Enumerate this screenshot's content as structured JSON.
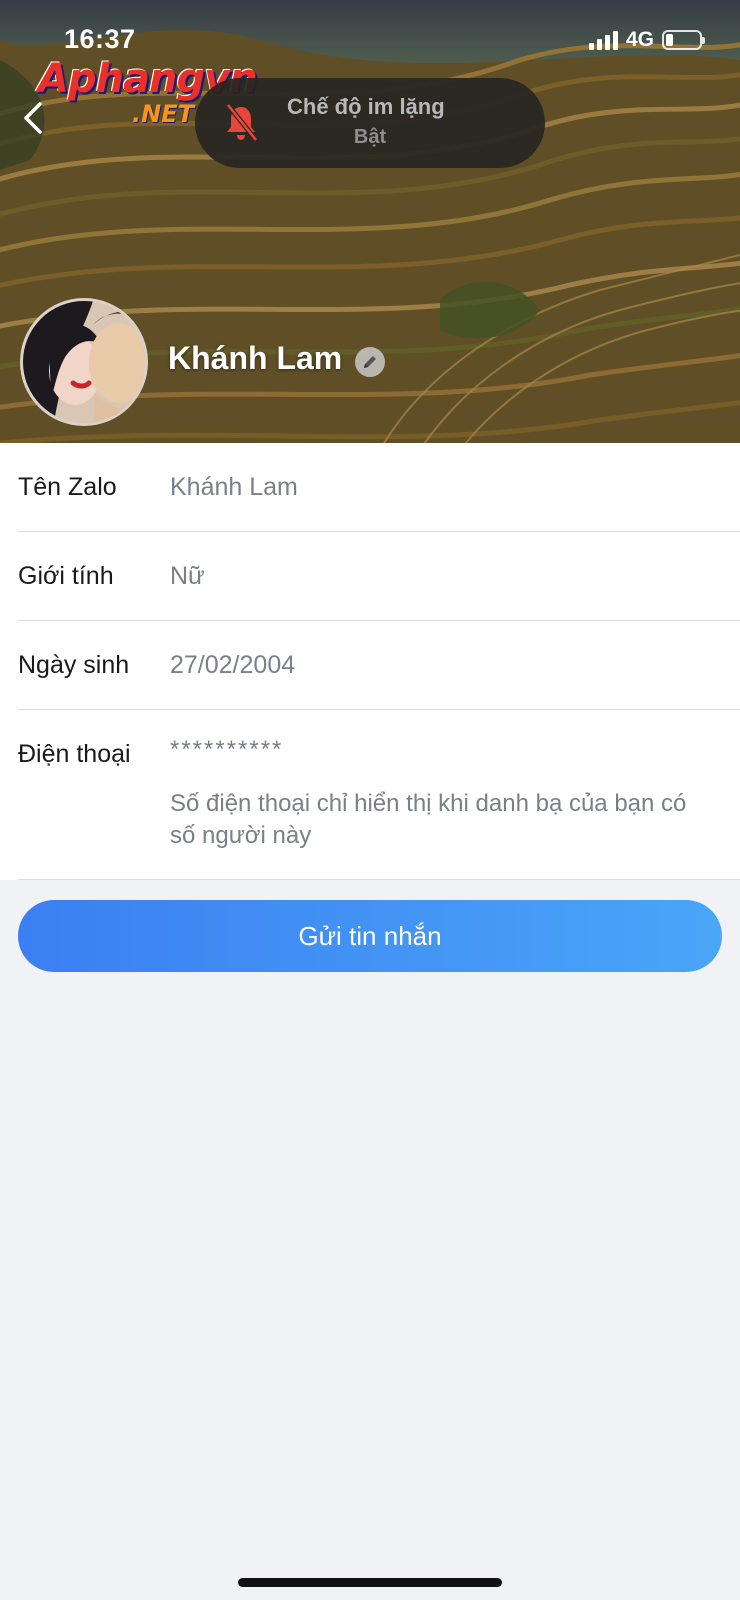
{
  "status_bar": {
    "time": "16:37",
    "network": "4G",
    "signal_bars": 4,
    "battery_level": 0.15
  },
  "watermark": {
    "name": "Aphangvn",
    "suffix": ".NET"
  },
  "header": {
    "back_icon": "chevron-left-icon"
  },
  "toast": {
    "icon": "bell-slash-icon",
    "icon_color": "#e8463a",
    "title": "Chế độ im lặng",
    "subtitle": "Bật"
  },
  "profile": {
    "name": "Khánh Lam",
    "edit_icon": "pencil-icon"
  },
  "info": {
    "zalo_name": {
      "label": "Tên Zalo",
      "value": "Khánh Lam"
    },
    "gender": {
      "label": "Giới tính",
      "value": "Nữ"
    },
    "birthday": {
      "label": "Ngày sinh",
      "value": "27/02/2004"
    },
    "phone": {
      "label": "Điện thoại",
      "value": "**********",
      "note": "Số điện thoại chỉ hiển thị khi danh bạ của bạn có số người này"
    }
  },
  "actions": {
    "send_message": "Gửi tin nhắn"
  },
  "colors": {
    "accent_start": "#3b7ff2",
    "accent_end": "#4aa6f7",
    "background": "#f0f2f5"
  }
}
